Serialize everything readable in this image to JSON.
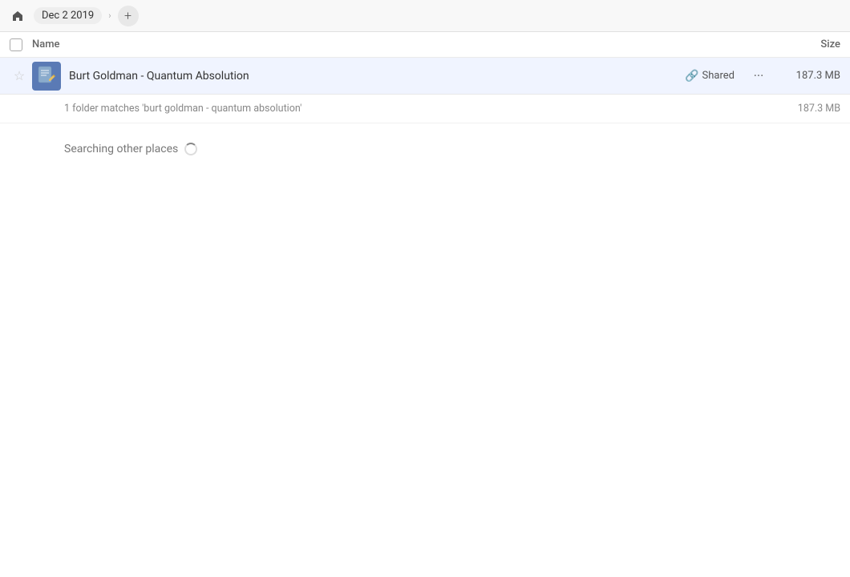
{
  "topbar": {
    "home_icon": "🏠",
    "breadcrumb_label": "Dec 2 2019",
    "add_icon": "+",
    "breadcrumb_arrow": "›"
  },
  "columns": {
    "name_label": "Name",
    "size_label": "Size"
  },
  "file_row": {
    "file_name": "Burt Goldman - Quantum Absolution",
    "shared_label": "Shared",
    "file_size": "187.3 MB",
    "more_icon": "···",
    "star_icon": "☆"
  },
  "match_row": {
    "match_text": "1 folder matches 'burt goldman - quantum absolution'",
    "match_size": "187.3 MB"
  },
  "searching": {
    "label": "Searching other places"
  }
}
